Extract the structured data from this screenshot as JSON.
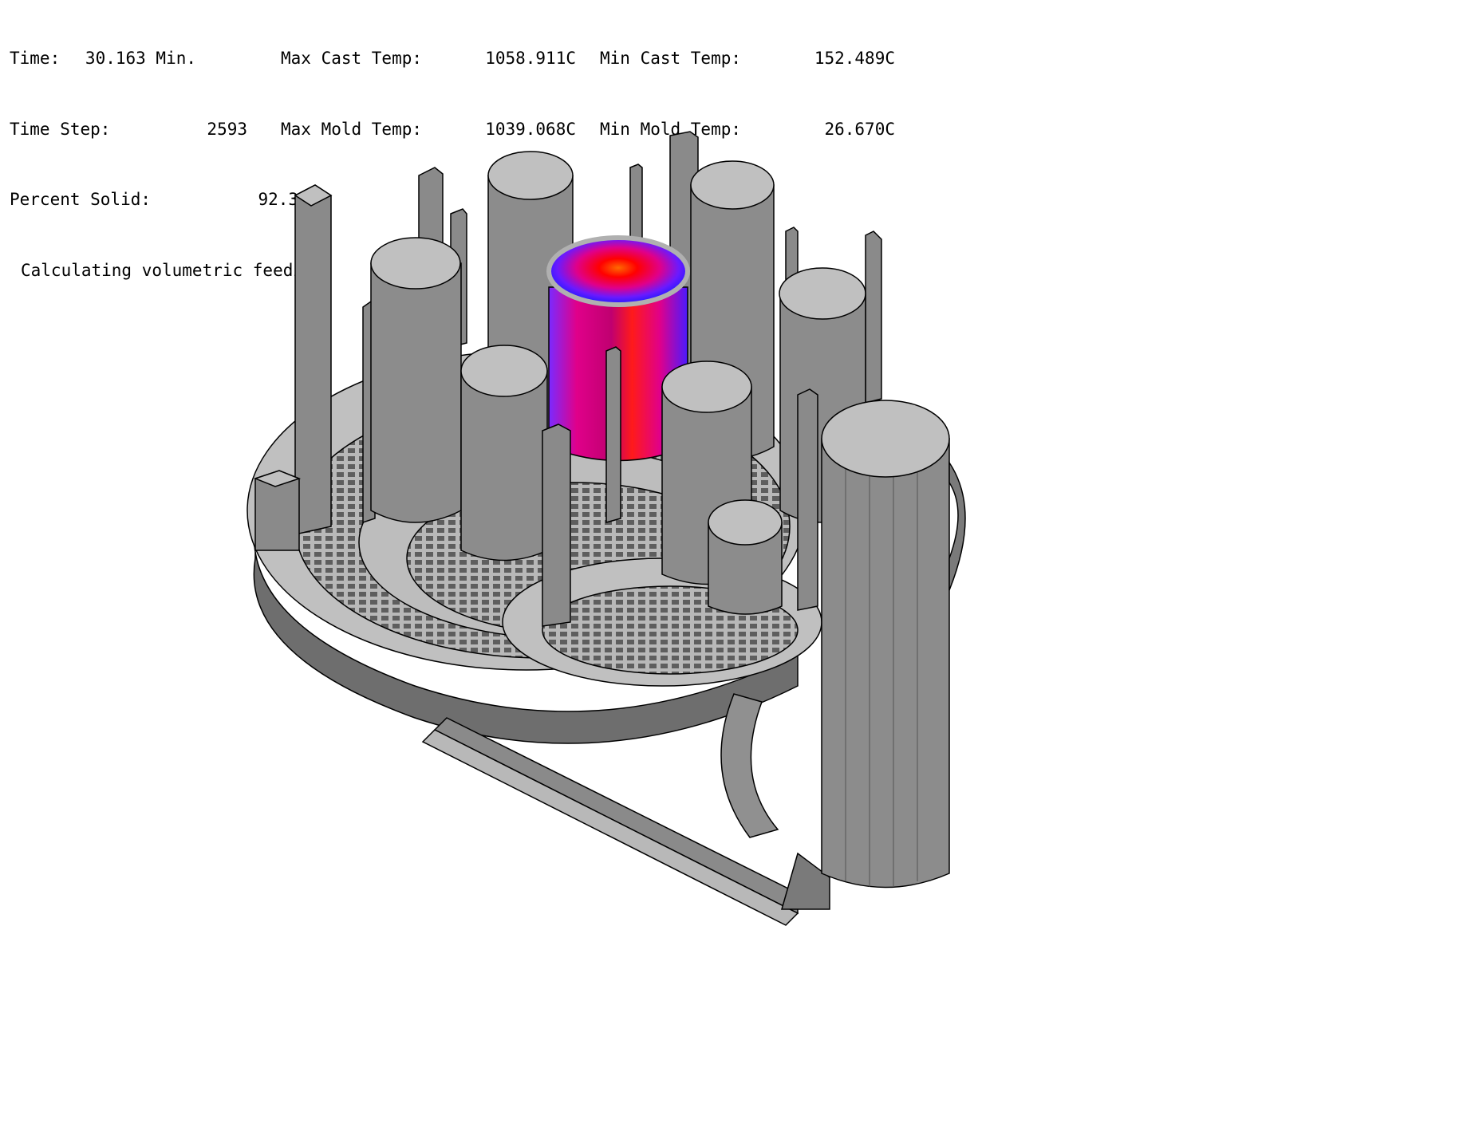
{
  "status": {
    "time_label": "Time:",
    "time_value": "30.163 Min.",
    "max_cast_temp_label": "Max Cast Temp:",
    "max_cast_temp_value": "1058.911C",
    "min_cast_temp_label": "Min Cast Temp:",
    "min_cast_temp_value": "152.489C",
    "time_step_label": "Time Step:",
    "time_step_value": "2593",
    "max_mold_temp_label": "Max Mold Temp:",
    "max_mold_temp_value": "1039.068C",
    "min_mold_temp_label": "Min Mold Temp:",
    "min_mold_temp_value": "26.670C",
    "percent_solid_label": "Percent Solid:",
    "percent_solid_value": "92.39 %",
    "message": "Calculating volumetric feeding"
  },
  "colors": {
    "background": "#ffffff",
    "top_face": "#c0c0c0",
    "side_face": "#808080",
    "dark_face": "#5a5a5a",
    "outline": "#000000",
    "hot_core": "#ff3000",
    "hot_mid": "#ff0000",
    "warm": "#e0008a",
    "cool": "#1a1aff"
  }
}
